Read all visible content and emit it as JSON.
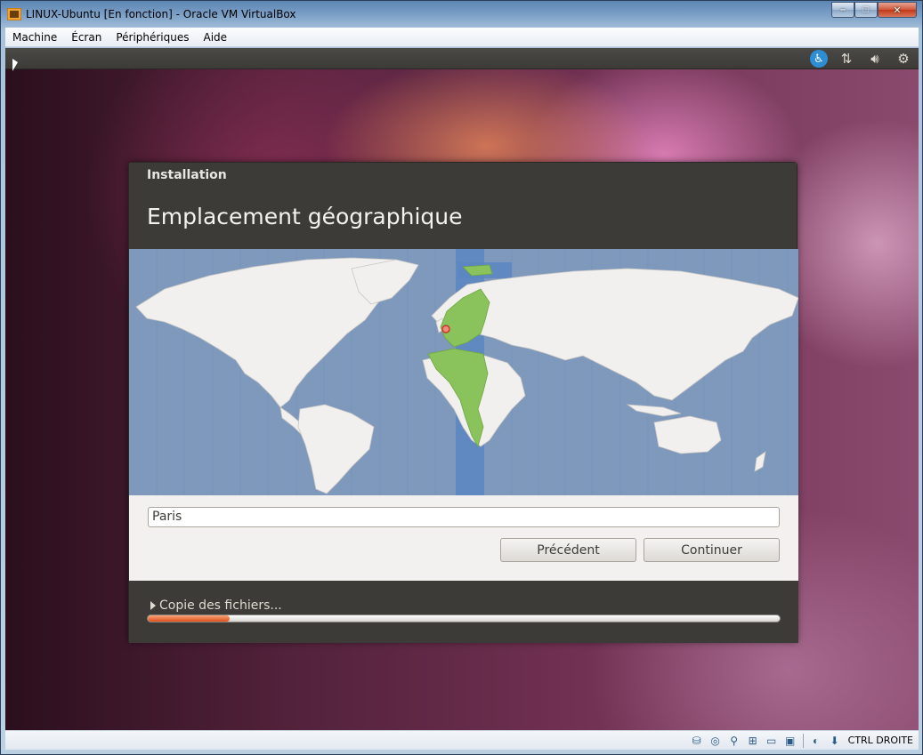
{
  "window": {
    "title": "LINUX-Ubuntu [En fonction] - Oracle VM VirtualBox",
    "buttons": {
      "minimize": "–",
      "maximize": "□",
      "close": "✕"
    }
  },
  "menubar": {
    "items": [
      {
        "label": "Machine"
      },
      {
        "label": "Écran"
      },
      {
        "label": "Périphériques"
      },
      {
        "label": "Aide"
      }
    ]
  },
  "ubuntu_panel": {
    "icons": [
      "accessibility-icon",
      "network-icon",
      "volume-icon",
      "power-icon"
    ]
  },
  "installer": {
    "title": "Installation",
    "heading": "Emplacement géographique",
    "city_value": "Paris",
    "buttons": {
      "previous": "Précédent",
      "continue": "Continuer"
    },
    "progress_label": "Copie des fichiers...",
    "progress_fraction": 0.13,
    "colors": {
      "ocean": "#7f99bd",
      "land": "#f2f0ee",
      "selected_timezone": "#8ac35b",
      "timezone_band": "#5b86c2",
      "progress": "#e25a20"
    }
  },
  "statusbar": {
    "icons": [
      "hard-disk-icon",
      "optical-drive-icon",
      "usb-icon",
      "network-adapter-icon",
      "shared-folder-icon",
      "display-icon",
      "virtualization-icon",
      "mouse-integration-icon"
    ],
    "host_key": "CTRL DROITE"
  }
}
